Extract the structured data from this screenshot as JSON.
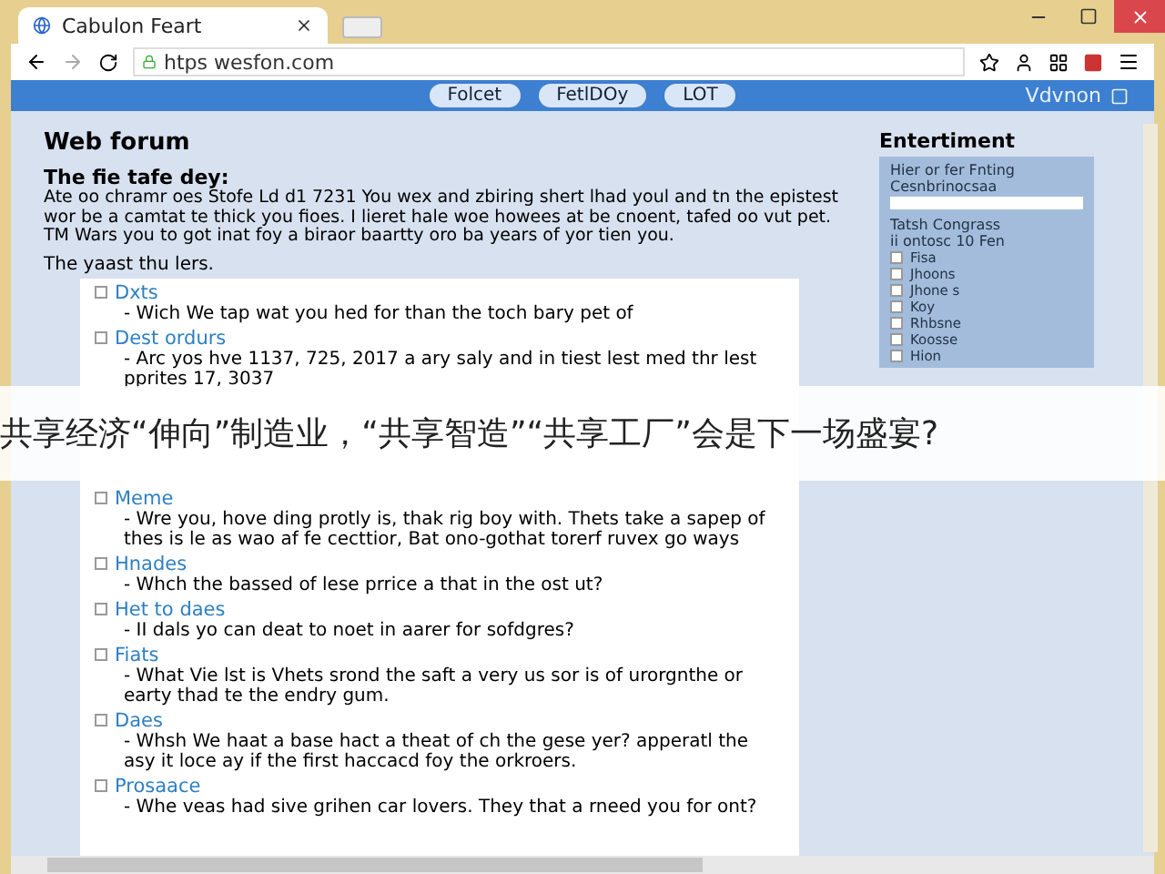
{
  "browser": {
    "tab_title": "Cabulon Feart",
    "url": "htps wesfon.com"
  },
  "nav": {
    "buttons": [
      "Folcet",
      "FetlDOy",
      "LOT"
    ],
    "brand": "Vdvnon"
  },
  "main": {
    "title": "Web forum",
    "subtitle": "The fie tafe dey:",
    "paragraph": "Ate oo chramr oes Stofe Ld d1 7231 You wex and zbiring shert lhad youl and tn the epistest wor be a camtat te thick you fioes. I lieret hale woe howees at be cnoent, tafed oo vut pet. TM Wars you to got inat foy a biraor baartty oro ba years of yor tien you.",
    "intro": "The yaast thu lers.",
    "topics": [
      {
        "title": "Dxts",
        "checked": false,
        "text": "- Wich We tap wat you hed for than the toch bary pet of"
      },
      {
        "title": "Dest ordurs",
        "checked": false,
        "text": "- Arc yos hve 1137, 725, 2017 a ary saly and in tiest lest med thr lest pprites 17, 3037"
      },
      {
        "kind": "covered"
      },
      {
        "title": "Meme",
        "checked": false,
        "text": "- Wre you, hove ding protly is, thak rig boy with. Thets take a sapep of thes is le as wao af fe cecttior, Bat ono-gothat torerf ruvex go ways"
      },
      {
        "title": "Hnades",
        "checked": false,
        "text": "- Whch the bassed of lese prrice a that in the ost ut?"
      },
      {
        "title": "Het to daes",
        "checked": false,
        "text": "- II dals yo can deat to noet in aarer for sofdgres?"
      },
      {
        "title": "Fiats",
        "checked": false,
        "text": "- What Vie lst is Vhets srond the saft a very us sor is of urorgnthe or earty thad te the endry gum."
      },
      {
        "title": "Daes",
        "checked": false,
        "text": "- Whsh We haat a base hact a theat of ch the gese yer? apperatl the asy it loce ay if the first haccacd foy the orkroers."
      },
      {
        "title": "Prosaace",
        "checked": false,
        "text": "- Whe veas had sive grihen car lovers. They that a rneed you for ont?"
      }
    ]
  },
  "sidebar": {
    "title": "Entertiment",
    "label": "Hier or fer Fnting",
    "sublabel": "Cesnbrinocsaa",
    "heading": "Tatsh Congrass",
    "subheading": "ii ontosc 10 Fen",
    "options": [
      {
        "label": "Fisa",
        "checked": false
      },
      {
        "label": "Jhoons",
        "checked": false
      },
      {
        "label": "Jhone s",
        "checked": false
      },
      {
        "label": "Koy",
        "checked": false
      },
      {
        "label": "Rhbsne",
        "checked": false
      },
      {
        "label": "Koosse",
        "checked": false
      },
      {
        "label": "Hion",
        "checked": false
      }
    ]
  },
  "banner": "共享经济“伸向”制造业，“共享智造”“共享工厂”会是下一场盛宴?"
}
